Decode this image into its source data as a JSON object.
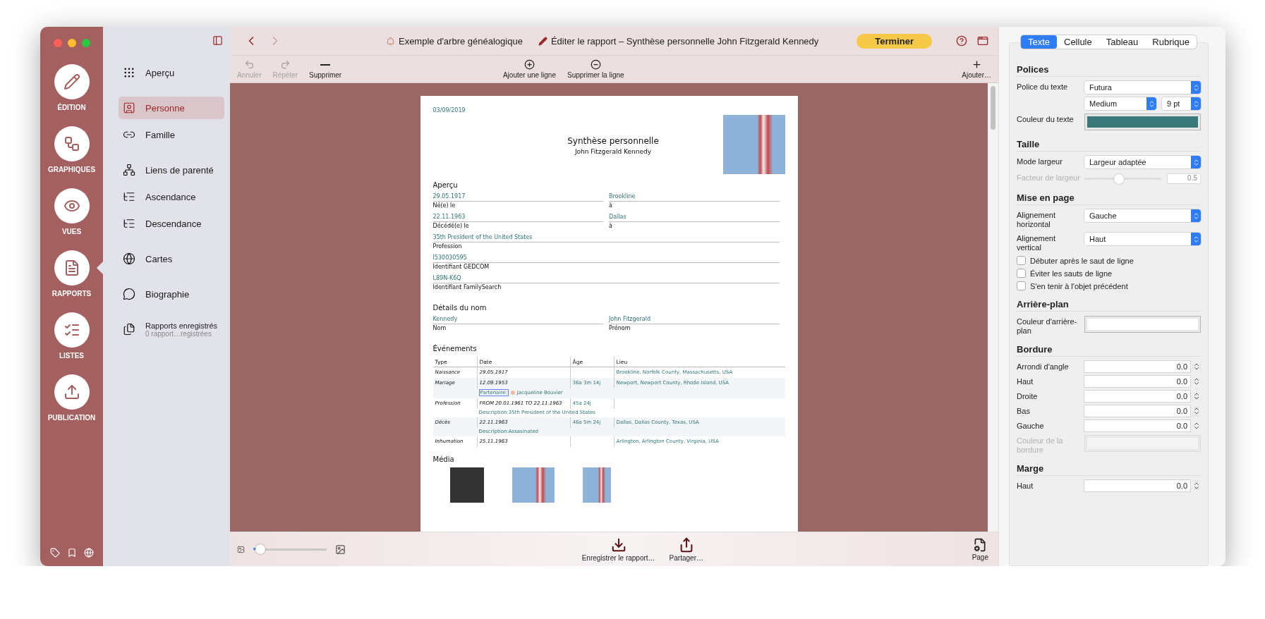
{
  "rail": {
    "items": [
      {
        "label": "ÉDITION",
        "selected": false
      },
      {
        "label": "GRAPHIQUES",
        "selected": false
      },
      {
        "label": "VUES",
        "selected": false
      },
      {
        "label": "RAPPORTS",
        "selected": true
      },
      {
        "label": "LISTES",
        "selected": false
      },
      {
        "label": "PUBLICATION",
        "selected": false
      }
    ]
  },
  "nav": {
    "groups": [
      [
        {
          "label": "Aperçu",
          "selected": false
        }
      ],
      [
        {
          "label": "Personne",
          "selected": true
        },
        {
          "label": "Famille",
          "selected": false
        }
      ],
      [
        {
          "label": "Liens de parenté",
          "selected": false
        },
        {
          "label": "Ascendance",
          "selected": false
        },
        {
          "label": "Descendance",
          "selected": false
        }
      ],
      [
        {
          "label": "Cartes",
          "selected": false
        }
      ],
      [
        {
          "label": "Biographie",
          "selected": false
        }
      ],
      [
        {
          "label": "Rapports enregistrés",
          "sublabel": "0 rapport…registrées",
          "selected": false
        }
      ]
    ]
  },
  "titlebar": {
    "document": "Exemple d'arbre généalogique",
    "title": "Éditer le rapport – Synthèse personnelle John Fitzgerald Kennedy",
    "done_button": "Terminer"
  },
  "toolbar": {
    "left": [
      {
        "label": "Annuler",
        "disabled": true
      },
      {
        "label": "Répéter",
        "disabled": true
      },
      {
        "label": "Supprimer",
        "disabled": false
      }
    ],
    "center": [
      {
        "label": "Ajouter une ligne",
        "disabled": false
      },
      {
        "label": "Supprimer la ligne",
        "disabled": false
      }
    ],
    "right": [
      {
        "label": "Ajouter…",
        "disabled": false
      }
    ]
  },
  "report": {
    "date": "03/09/2019",
    "title": "Synthèse personnelle",
    "subtitle": "John Fitzgerald Kennedy",
    "overview": {
      "title": "Aperçu",
      "fields": [
        {
          "value": "29.05.1917",
          "label": "Né(e) le",
          "wide": false
        },
        {
          "value": "Brookline",
          "label": "à",
          "wide": false
        },
        {
          "value": "22.11.1963",
          "label": "Décédé(e) le",
          "wide": false
        },
        {
          "value": "Dallas",
          "label": "à",
          "wide": false
        },
        {
          "value": "35th President of the United States",
          "label": "Profession",
          "wide": true
        },
        {
          "value": "I530030595",
          "label": "Identifiant GEDCOM",
          "wide": true
        },
        {
          "value": "L89N-K6Q",
          "label": "Identifiant FamilySearch",
          "wide": true
        }
      ]
    },
    "name_details": {
      "title": "Détails du nom",
      "fields": [
        {
          "value": "Kennedy",
          "label": "Nom",
          "wide": false
        },
        {
          "value": "John Fitzgerald",
          "label": "Prénom",
          "wide": false
        }
      ]
    },
    "events": {
      "title": "Événements",
      "columns": [
        "Type",
        "Date",
        "Âge",
        "Lieu"
      ],
      "rows": [
        {
          "type": "Naissance",
          "date": "29.05.1917",
          "age": "",
          "place": "Brookline, Norfolk County, Massachusetts, USA"
        },
        {
          "type": "Mariage",
          "date": "12.09.1953",
          "age": "36a 3m 14j",
          "place": "Newport, Newport County, Rhode Island, USA",
          "extra": {
            "label": "Partenaire:",
            "selected": true,
            "text": "Jacqueline Bouvier"
          }
        },
        {
          "type": "Profession",
          "date": "FROM 20.01.1961 TO 22.11.1963",
          "age": "45a 24j",
          "place": "",
          "extra": {
            "text": "Description:35th President of the United States"
          }
        },
        {
          "type": "Décès",
          "date": "22.11.1963",
          "age": "46a 5m 24j",
          "place": "Dallas, Dallas County, Texas, USA",
          "extra": {
            "text": "Description:Assasinated"
          }
        },
        {
          "type": "Inhumation",
          "date": "25.11.1963",
          "age": "",
          "place": "Arlington, Arlington County, Virginia, USA"
        }
      ]
    },
    "media": {
      "title": "Média",
      "items": [
        {
          "kind": "photo"
        },
        {
          "kind": "photo"
        },
        {
          "kind": "photo"
        }
      ]
    }
  },
  "bottombar": {
    "zoom": {
      "level": 0.1
    },
    "buttons": [
      {
        "label": "Enregistrer le rapport…"
      },
      {
        "label": "Partager…"
      }
    ],
    "page_button": "Page"
  },
  "inspector": {
    "tabs": [
      {
        "label": "Texte",
        "selected": true
      },
      {
        "label": "Cellule",
        "selected": false
      },
      {
        "label": "Tableau",
        "selected": false
      },
      {
        "label": "Rubrique",
        "selected": false
      }
    ],
    "sections": [
      {
        "title": "Polices",
        "rows": [
          {
            "kind": "select",
            "label": "Police du texte",
            "value": "Futura",
            "disabled": false
          },
          {
            "kind": "select_pair",
            "value": "Medium",
            "value2": "9 pt",
            "disabled": false
          },
          {
            "kind": "color",
            "label": "Couleur du texte",
            "color": "#3b787a",
            "disabled": false
          }
        ]
      },
      {
        "title": "Taille",
        "rows": [
          {
            "kind": "select",
            "label": "Mode largeur",
            "value": "Largeur adaptée",
            "disabled": false
          },
          {
            "kind": "slider",
            "label": "Facteur de largeur",
            "level": 0.45,
            "value": "0.5",
            "disabled": true
          }
        ]
      },
      {
        "title": "Mise en page",
        "rows": [
          {
            "kind": "select",
            "label": "Alignement horizontal",
            "value": "Gauche",
            "disabled": false
          },
          {
            "kind": "select",
            "label": "Alignement vertical",
            "value": "Haut",
            "disabled": false
          },
          {
            "kind": "checkbox",
            "label": "Débuter après le saut de ligne",
            "checked": false,
            "disabled": false
          },
          {
            "kind": "checkbox",
            "label": "Éviter les sauts de ligne",
            "checked": false,
            "disabled": false
          },
          {
            "kind": "checkbox",
            "label": "S'en tenir à l'objet précédent",
            "checked": false,
            "disabled": false
          }
        ]
      },
      {
        "title": "Arrière-plan",
        "rows": [
          {
            "kind": "color",
            "label": "Couleur d'arrière-plan",
            "color": "#ffffff",
            "disabled": false
          }
        ]
      },
      {
        "title": "Bordure",
        "rows": [
          {
            "kind": "stepper",
            "label": "Arrondi d'angle",
            "value": "0.0",
            "disabled": false
          },
          {
            "kind": "stepper",
            "label": "Haut",
            "value": "0.0",
            "disabled": false
          },
          {
            "kind": "stepper",
            "label": "Droite",
            "value": "0.0",
            "disabled": false
          },
          {
            "kind": "stepper",
            "label": "Bas",
            "value": "0.0",
            "disabled": false
          },
          {
            "kind": "stepper",
            "label": "Gauche",
            "value": "0.0",
            "disabled": false
          },
          {
            "kind": "color",
            "label": "Couleur de la bordure",
            "color": "#f4f4f4",
            "disabled": true
          }
        ]
      },
      {
        "title": "Marge",
        "rows": [
          {
            "kind": "stepper",
            "label": "Haut",
            "value": "0.0",
            "disabled": false
          }
        ]
      }
    ]
  }
}
